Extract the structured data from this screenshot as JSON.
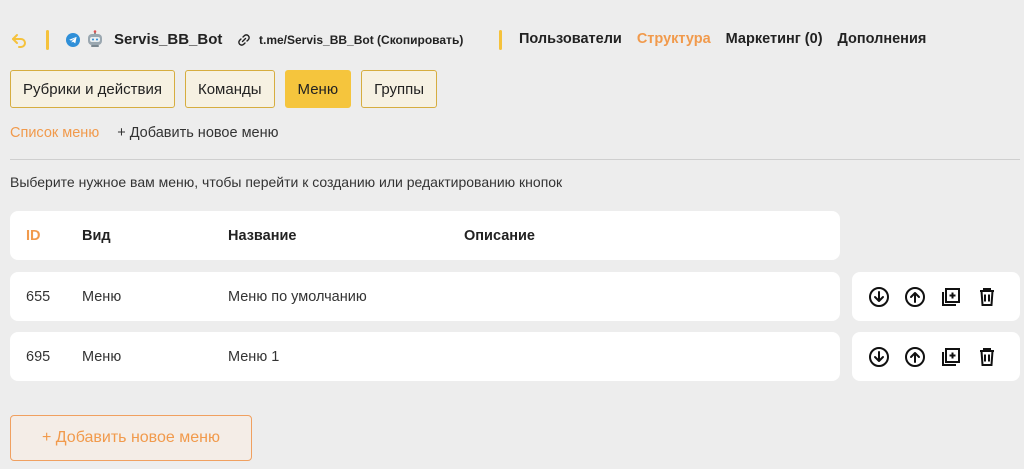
{
  "header": {
    "bot_name": "Servis_BB_Bot",
    "bot_link": "t.me/Servis_BB_Bot (Скопировать)",
    "nav": [
      {
        "label": "Пользователи",
        "active": false
      },
      {
        "label": "Структура",
        "active": true
      },
      {
        "label": "Маркетинг (0)",
        "active": false
      },
      {
        "label": "Дополнения",
        "active": false
      }
    ]
  },
  "tabs": [
    {
      "label": "Рубрики и действия",
      "active": false
    },
    {
      "label": "Команды",
      "active": false
    },
    {
      "label": "Меню",
      "active": true
    },
    {
      "label": "Группы",
      "active": false
    }
  ],
  "subnav": {
    "list_label": "Список меню",
    "add_label": "+ Добавить новое меню"
  },
  "hint": "Выберите нужное вам меню, чтобы перейти к созданию или редактированию кнопок",
  "table": {
    "columns": {
      "id": "ID",
      "type": "Вид",
      "name": "Название",
      "description": "Описание"
    },
    "rows": [
      {
        "id": "655",
        "type": "Меню",
        "name": "Меню по умолчанию",
        "description": ""
      },
      {
        "id": "695",
        "type": "Меню",
        "name": "Меню 1",
        "description": ""
      }
    ],
    "row_actions": [
      "move-down-icon",
      "move-up-icon",
      "duplicate-icon",
      "delete-icon"
    ]
  },
  "add_button_label": "+ Добавить новое меню",
  "colors": {
    "accent_orange": "#f19a4c",
    "accent_yellow": "#f5c53d",
    "background": "#ededed"
  }
}
